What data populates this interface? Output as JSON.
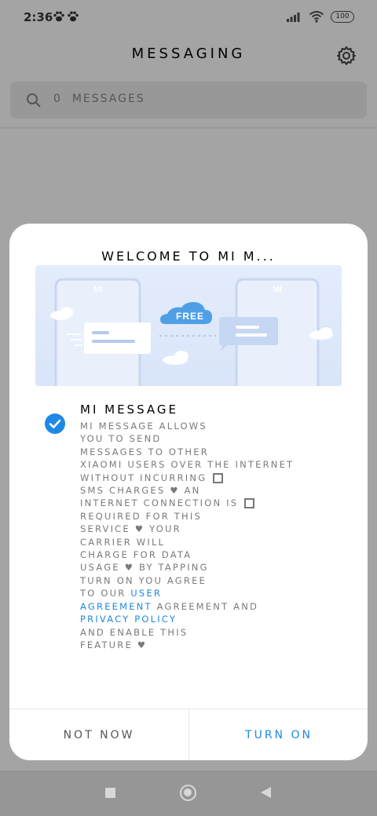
{
  "status_bar": {
    "time": "2:36",
    "battery": "100"
  },
  "header": {
    "title": "MESSAGING"
  },
  "search": {
    "count": "0",
    "placeholder": "MESSAGES"
  },
  "dialog": {
    "title": "WELCOME TO MI M...",
    "illustration": {
      "brand_left": "MI",
      "brand_right": "MI",
      "cloud_label": "FREE"
    },
    "body_title": "MI MESSAGE",
    "body_lines": [
      "MI MESSAGE ALLOWS",
      "YOU TO SEND",
      "MESSAGES TO OTHER",
      "XIAOMI USERS OVER THE INTERNET",
      "WITHOUT INCURRING",
      "SMS CHARGES ♥ AN",
      "INTERNET CONNECTION IS",
      "REQUIRED FOR THIS",
      "SERVICE ♥ YOUR",
      "CARRIER WILL",
      "CHARGE FOR DATA",
      "USAGE ♥ BY TAPPING",
      "TURN ON YOU AGREE",
      "TO OUR",
      "AGREEMENT AND",
      "PRIVACY POLICY",
      "AND ENABLE THIS",
      "FEATURE ♥"
    ],
    "link_user": "USER",
    "link_agreement": "AGREEMENT",
    "link_privacy": "PRIVACY POLICY",
    "button_left": "NOT NOW",
    "button_right": "TURN ON"
  },
  "colors": {
    "accent": "#1e88e5",
    "scrim": "#a4a4a4"
  }
}
